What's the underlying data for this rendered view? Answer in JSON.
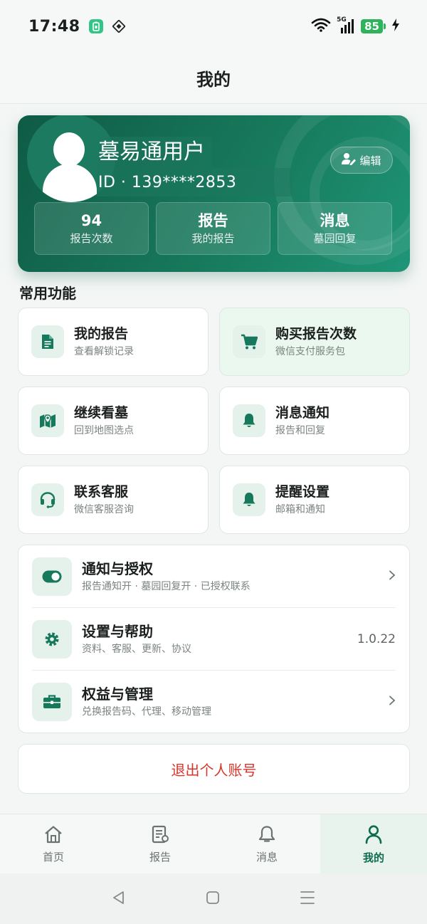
{
  "status_bar": {
    "time": "17:48",
    "network": "5G",
    "battery": "85"
  },
  "header": {
    "title": "我的"
  },
  "profile": {
    "username": "墓易通用户",
    "user_id": "ID · 139****2853",
    "edit_label": "编辑",
    "stats": [
      {
        "value": "94",
        "label": "报告次数"
      },
      {
        "value": "报告",
        "label": "我的报告"
      },
      {
        "value": "消息",
        "label": "墓园回复"
      }
    ]
  },
  "section": {
    "title": "常用功能"
  },
  "features": [
    {
      "title": "我的报告",
      "subtitle": "查看解锁记录",
      "icon": "document-icon"
    },
    {
      "title": "购买报告次数",
      "subtitle": "微信支付服务包",
      "icon": "cart-icon"
    },
    {
      "title": "继续看墓",
      "subtitle": "回到地图选点",
      "icon": "map-icon"
    },
    {
      "title": "消息通知",
      "subtitle": "报告和回复",
      "icon": "bell-icon"
    },
    {
      "title": "联系客服",
      "subtitle": "微信客服咨询",
      "icon": "headset-icon"
    },
    {
      "title": "提醒设置",
      "subtitle": "邮箱和通知",
      "icon": "bell-icon"
    }
  ],
  "settings": [
    {
      "title": "通知与授权",
      "subtitle": "报告通知开 · 墓园回复开 · 已授权联系",
      "right": "›",
      "icon": "toggle-icon"
    },
    {
      "title": "设置与帮助",
      "subtitle": "资料、客服、更新、协议",
      "right": "1.0.22",
      "icon": "gear-icon"
    },
    {
      "title": "权益与管理",
      "subtitle": "兑换报告码、代理、移动管理",
      "right": "›",
      "icon": "toolbox-icon"
    }
  ],
  "logout_label": "退出个人账号",
  "tabs": [
    {
      "label": "首页",
      "icon": "home-icon"
    },
    {
      "label": "报告",
      "icon": "report-icon"
    },
    {
      "label": "消息",
      "icon": "bell-icon"
    },
    {
      "label": "我的",
      "icon": "person-icon",
      "active": true
    }
  ],
  "colors": {
    "brand": "#17795b",
    "brand_dark": "#0f5b45",
    "danger": "#d9342b",
    "background": "#f3f6f4"
  }
}
